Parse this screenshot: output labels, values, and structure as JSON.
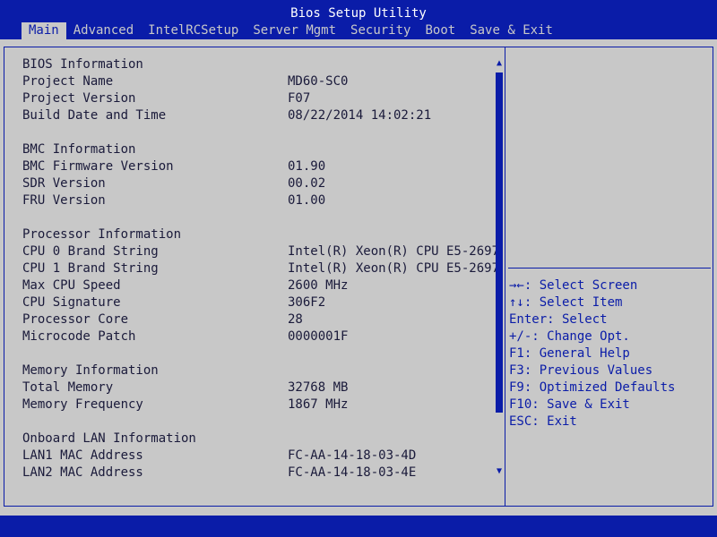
{
  "title": "Bios Setup Utility",
  "tabs": [
    {
      "label": "Main"
    },
    {
      "label": "Advanced"
    },
    {
      "label": "IntelRCSetup"
    },
    {
      "label": "Server Mgmt"
    },
    {
      "label": "Security"
    },
    {
      "label": "Boot"
    },
    {
      "label": "Save & Exit"
    }
  ],
  "main": {
    "rows": [
      {
        "label": "BIOS Information",
        "value": ""
      },
      {
        "label": "Project Name",
        "value": "MD60-SC0"
      },
      {
        "label": "Project Version",
        "value": "F07"
      },
      {
        "label": "Build Date and Time",
        "value": "08/22/2014 14:02:21"
      },
      {
        "label": "",
        "value": ""
      },
      {
        "label": "BMC Information",
        "value": ""
      },
      {
        "label": "BMC Firmware Version",
        "value": "01.90"
      },
      {
        "label": "SDR Version",
        "value": "00.02"
      },
      {
        "label": "FRU Version",
        "value": "01.00"
      },
      {
        "label": "",
        "value": ""
      },
      {
        "label": "Processor Information",
        "value": ""
      },
      {
        "label": "CPU 0 Brand String",
        "value": "Intel(R) Xeon(R) CPU E5-2697"
      },
      {
        "label": "CPU 1 Brand String",
        "value": "Intel(R) Xeon(R) CPU E5-2697"
      },
      {
        "label": "Max CPU Speed",
        "value": "2600 MHz"
      },
      {
        "label": "CPU Signature",
        "value": "306F2"
      },
      {
        "label": "Processor Core",
        "value": "28"
      },
      {
        "label": "Microcode Patch",
        "value": "0000001F"
      },
      {
        "label": "",
        "value": ""
      },
      {
        "label": "Memory Information",
        "value": ""
      },
      {
        "label": "Total Memory",
        "value": "32768 MB"
      },
      {
        "label": "Memory Frequency",
        "value": "1867 MHz"
      },
      {
        "label": "",
        "value": ""
      },
      {
        "label": "Onboard LAN Information",
        "value": ""
      },
      {
        "label": "LAN1 MAC Address",
        "value": "FC-AA-14-18-03-4D"
      },
      {
        "label": "LAN2 MAC Address",
        "value": "FC-AA-14-18-03-4E"
      }
    ],
    "scroll_up_icon": "▲",
    "scroll_down_icon": "▼"
  },
  "help": {
    "items": [
      "→←: Select Screen",
      "↑↓: Select Item",
      "Enter: Select",
      "+/-: Change Opt.",
      "F1: General Help",
      "F3: Previous Values",
      "F9: Optimized Defaults",
      "F10: Save & Exit",
      "ESC: Exit"
    ]
  },
  "colors": {
    "accent": "#0a1ca8",
    "background": "#c8c8c8"
  }
}
